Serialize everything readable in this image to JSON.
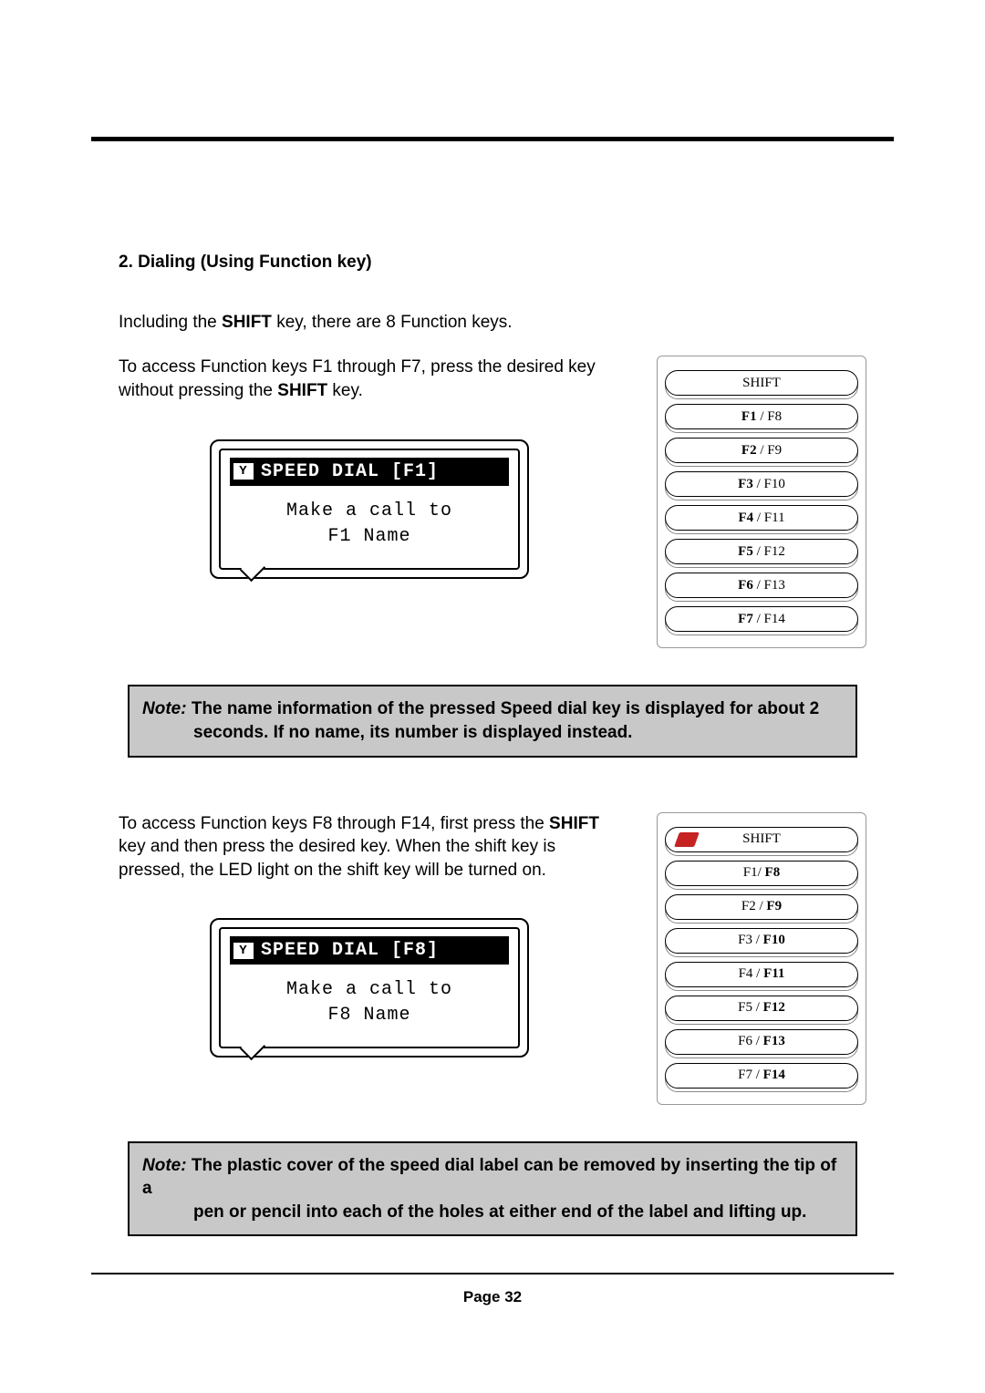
{
  "heading": "2. Dialing (Using Function key)",
  "para1_a": "Including the ",
  "para1_b": "SHIFT",
  "para1_c": " key, there are 8 Function keys.",
  "para2_a": "To access Function keys F1 through F7, press the desired key without pressing the ",
  "para2_b": "SHIFT",
  "para2_c": " key.",
  "lcd1": {
    "title": "SPEED DIAL [F1]",
    "line1": "Make a call to",
    "line2": "F1 Name",
    "icon": "Y"
  },
  "keys1": {
    "shift": "SHIFT",
    "k1a": "F1",
    "k1b": " / F8",
    "k2a": "F2",
    "k2b": " / F9",
    "k3a": "F3",
    "k3b": " / F10",
    "k4a": "F4",
    "k4b": " / F11",
    "k5a": "F5",
    "k5b": " / F12",
    "k6a": "F6",
    "k6b": " / F13",
    "k7a": "F7",
    "k7b": " / F14"
  },
  "note1": {
    "label": "Note:",
    "line1": " The name information of the pressed Speed dial key is displayed for about 2",
    "line2": "seconds. If no name, its number is displayed instead."
  },
  "para3_a": "To access Function keys F8 through F14, first press the ",
  "para3_b": "SHIFT",
  "para3_c": " key and then press the desired key. When the shift key is pressed, the LED light on the shift key will be turned on.",
  "lcd2": {
    "title": "SPEED DIAL [F8]",
    "line1": "Make a call to",
    "line2": "F8 Name",
    "icon": "Y"
  },
  "keys2": {
    "shift": "SHIFT",
    "k1a": "F1/ ",
    "k1b": "F8",
    "k2a": "F2 / ",
    "k2b": "F9",
    "k3a": "F3 / ",
    "k3b": "F10",
    "k4a": "F4 / ",
    "k4b": "F11",
    "k5a": "F5 / ",
    "k5b": "F12",
    "k6a": "F6 / ",
    "k6b": "F13",
    "k7a": "F7 / ",
    "k7b": "F14"
  },
  "note2": {
    "label": "Note:",
    "line1": " The plastic cover of the speed dial label can be removed by inserting the tip of a",
    "line2": "pen or pencil into each of the holes at either end of the label and lifting up."
  },
  "footer": "Page 32"
}
